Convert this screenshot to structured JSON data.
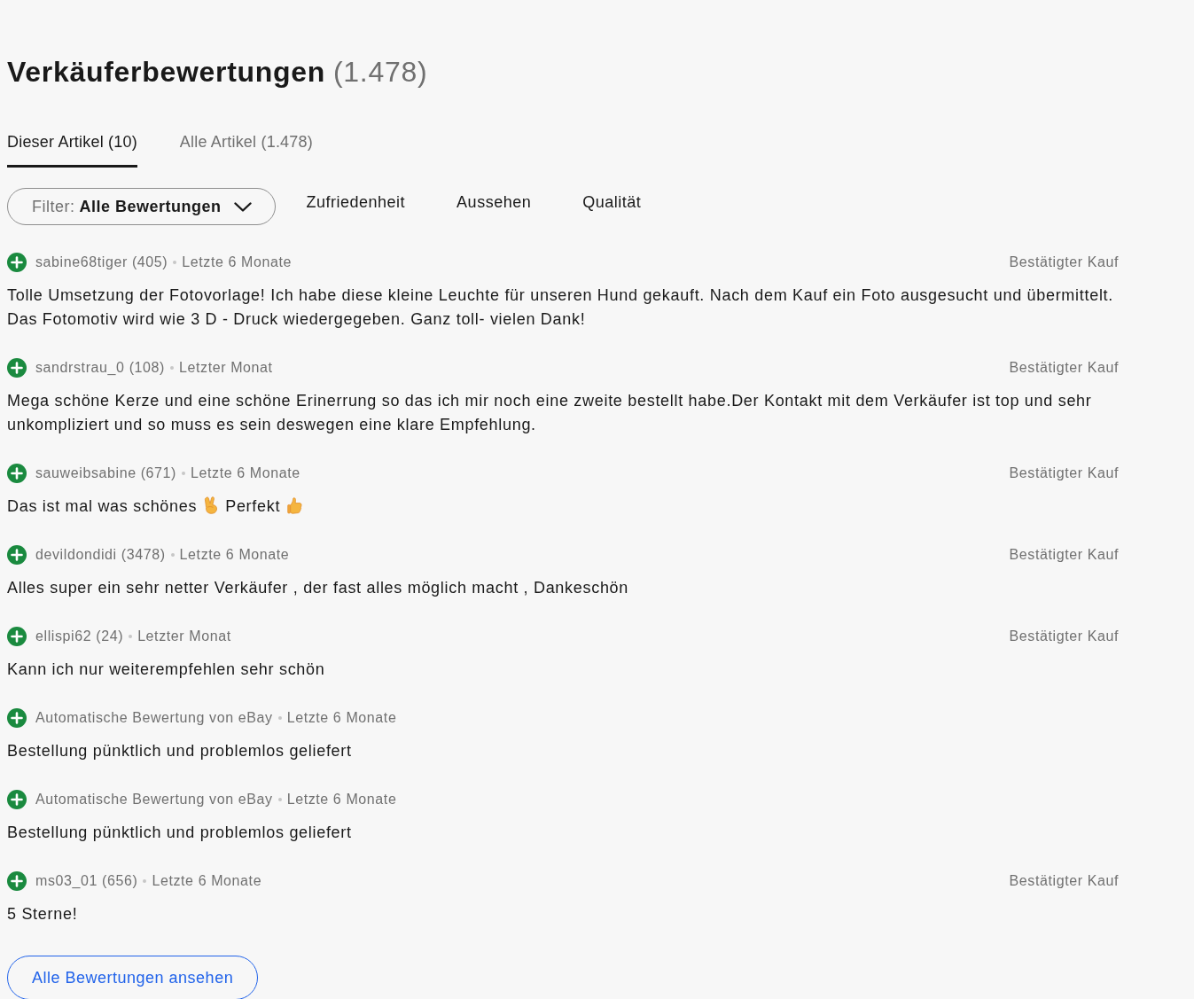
{
  "heading": {
    "title": "Verkäuferbewertungen",
    "count": "(1.478)"
  },
  "tabs": [
    {
      "label": "Dieser Artikel (10)",
      "selected": true
    },
    {
      "label": "Alle Artikel (1.478)",
      "selected": false
    }
  ],
  "filter": {
    "label": "Filter:",
    "value": "Alle Bewertungen"
  },
  "facets": [
    {
      "label": "Zufriedenheit",
      "selected": false
    },
    {
      "label": "Aussehen",
      "selected": false
    },
    {
      "label": "Qualität",
      "selected": false
    }
  ],
  "reviews": [
    {
      "positive": true,
      "user": "sabine68tiger (405)",
      "period": "Letzte 6 Monate",
      "badge": "Bestätigter Kauf",
      "body": [
        {
          "kind": "text",
          "text": "Tolle Umsetzung der Fotovorlage! Ich habe diese kleine Leuchte für unseren Hund gekauft. Nach dem Kauf ein Foto ausgesucht und übermittelt. Das Fotomotiv wird wie 3 D - Druck wiedergegeben. Ganz toll- vielen Dank!"
        }
      ]
    },
    {
      "positive": true,
      "user": "sandrstrau_0 (108)",
      "period": "Letzter Monat",
      "badge": "Bestätigter Kauf",
      "body": [
        {
          "kind": "text",
          "text": "Mega schöne Kerze und eine schöne Erinerrung so das ich mir noch eine zweite bestellt habe.Der Kontakt mit dem Verkäufer ist top und sehr unkompliziert und so muss es sein deswegen eine klare Empfehlung."
        }
      ]
    },
    {
      "positive": true,
      "user": "sauweibsabine (671)",
      "period": "Letzte 6 Monate",
      "badge": "Bestätigter Kauf",
      "body": [
        {
          "kind": "text",
          "text": "Das ist mal was schönes"
        },
        {
          "kind": "victory"
        },
        {
          "kind": "text",
          "text": "Perfekt"
        },
        {
          "kind": "thumbsup"
        }
      ]
    },
    {
      "positive": true,
      "user": "devildondidi (3478)",
      "period": "Letzte 6 Monate",
      "badge": "Bestätigter Kauf",
      "body": [
        {
          "kind": "text",
          "text": "Alles super ein sehr netter Verkäufer , der fast alles möglich macht , Dankeschön"
        }
      ]
    },
    {
      "positive": true,
      "user": "ellispi62 (24)",
      "period": "Letzter Monat",
      "badge": "Bestätigter Kauf",
      "body": [
        {
          "kind": "text",
          "text": "Kann ich nur weiterempfehlen sehr schön"
        }
      ]
    },
    {
      "positive": true,
      "user": "Automatische Bewertung von eBay",
      "period": "Letzte 6 Monate",
      "body": [
        {
          "kind": "text",
          "text": "Bestellung pünktlich und problemlos geliefert"
        }
      ]
    },
    {
      "positive": true,
      "user": "Automatische Bewertung von eBay",
      "period": "Letzte 6 Monate",
      "body": [
        {
          "kind": "text",
          "text": "Bestellung pünktlich und problemlos geliefert"
        }
      ]
    },
    {
      "positive": true,
      "user": "ms03_01 (656)",
      "period": "Letzte 6 Monate",
      "badge": "Bestätigter Kauf",
      "body": [
        {
          "kind": "text",
          "text": "5 Sterne!"
        }
      ]
    }
  ],
  "more_button": "Alle Bewertungen ansehen"
}
